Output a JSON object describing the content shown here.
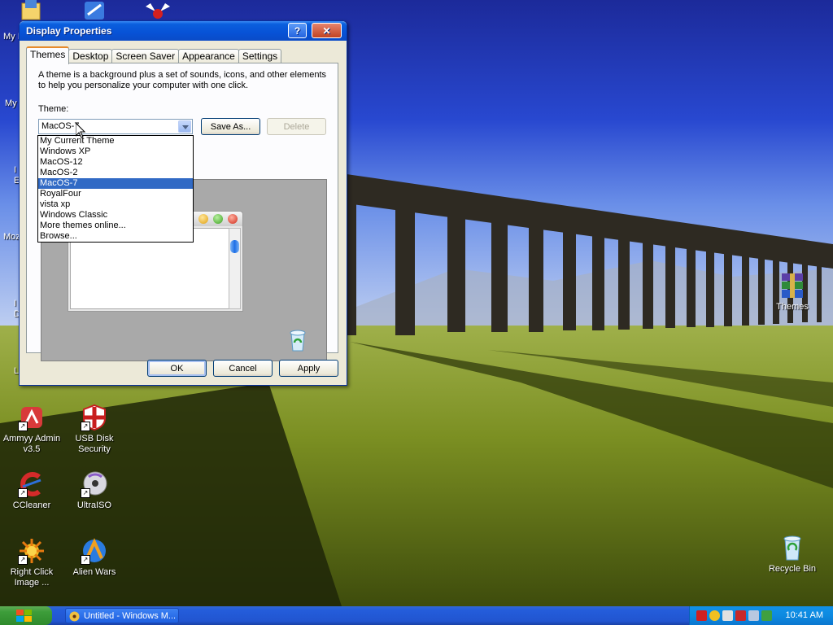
{
  "dialog": {
    "title": "Display Properties",
    "help_label": "?",
    "close_label": "✕",
    "tabs": [
      {
        "label": "Themes"
      },
      {
        "label": "Desktop"
      },
      {
        "label": "Screen Saver"
      },
      {
        "label": "Appearance"
      },
      {
        "label": "Settings"
      }
    ],
    "description": "A theme is a background plus a set of sounds, icons, and other elements to help you personalize your computer with one click.",
    "theme_label": "Theme:",
    "theme_value": "MacOS-7",
    "save_as_label": "Save As...",
    "delete_label": "Delete",
    "dropdown_items": [
      {
        "label": "My Current Theme"
      },
      {
        "label": "Windows XP"
      },
      {
        "label": "MacOS-12"
      },
      {
        "label": "MacOS-2"
      },
      {
        "label": "MacOS-7"
      },
      {
        "label": "RoyalFour"
      },
      {
        "label": "vista xp"
      },
      {
        "label": "Windows Classic"
      },
      {
        "label": "More themes online..."
      },
      {
        "label": "Browse..."
      }
    ],
    "selected_index": 4,
    "ok_label": "OK",
    "cancel_label": "Cancel",
    "apply_label": "Apply"
  },
  "desktop": {
    "edge_labels": [
      {
        "text": "My I"
      },
      {
        "text": "My"
      },
      {
        "text": "I"
      },
      {
        "text": "E"
      },
      {
        "text": "Moz"
      },
      {
        "text": "I"
      },
      {
        "text": "D"
      },
      {
        "text": "L"
      }
    ],
    "icons": [
      {
        "label": "Ammyy Admin v3.5",
        "icon": "ammyy-icon"
      },
      {
        "label": "USB Disk Security",
        "icon": "usb-disk-security-icon"
      },
      {
        "label": "CCleaner",
        "icon": "ccleaner-icon"
      },
      {
        "label": "UltraISO",
        "icon": "ultraiso-icon"
      },
      {
        "label": "Right Click Image ...",
        "icon": "right-click-image-icon"
      },
      {
        "label": "Alien Wars",
        "icon": "alien-wars-icon"
      },
      {
        "label": "Themes",
        "icon": "winrar-archive-icon"
      },
      {
        "label": "Recycle Bin",
        "icon": "recycle-bin-icon"
      }
    ]
  },
  "taskbar": {
    "task_label": "Untitled - Windows M...",
    "clock": "10:41 AM"
  },
  "colors": {
    "xp_blue": "#0752d6",
    "selection": "#316ac5",
    "tab_accent": "#e68b2c"
  }
}
